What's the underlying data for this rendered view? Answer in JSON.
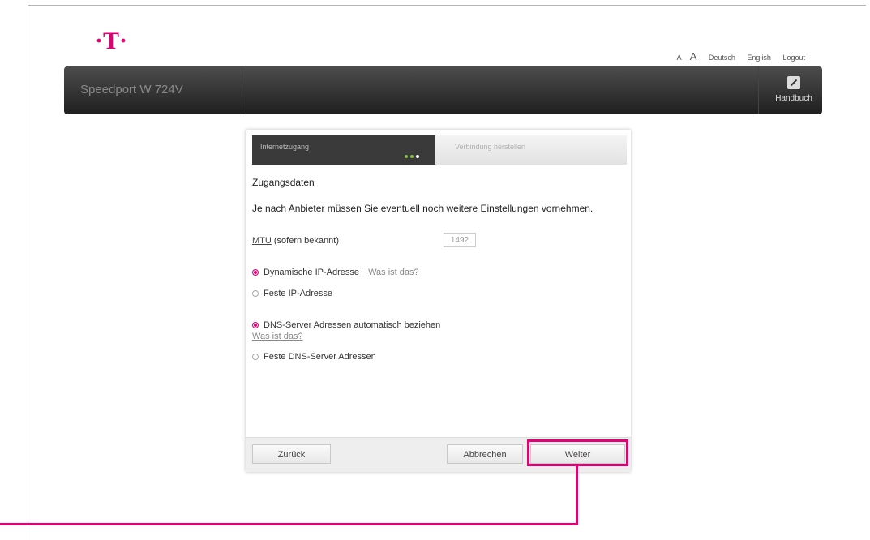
{
  "top_links": {
    "font_small": "A",
    "font_large": "A",
    "lang_de": "Deutsch",
    "lang_en": "English",
    "logout": "Logout"
  },
  "header": {
    "product": "Speedport W 724V",
    "handbook": "Handbuch"
  },
  "wizard": {
    "step1": "Internetzugang",
    "step2": "Verbindung herstellen",
    "title": "Zugangsdaten",
    "intro": "Je nach Anbieter müssen Sie eventuell noch weitere Einstellungen vornehmen.",
    "mtu_abbr": "MTU",
    "mtu_rest": " (sofern bekannt)",
    "mtu_value": "1492",
    "ip_dynamic": "Dynamische IP-Adresse",
    "help_link": "Was ist das?",
    "ip_static": "Feste IP-Adresse",
    "dns_auto": "DNS-Server Adressen automatisch beziehen",
    "dns_help_link": "Was ist das?",
    "dns_static": "Feste DNS-Server Adressen",
    "btn_back": "Zurück",
    "btn_cancel": "Abbrechen",
    "btn_next": "Weiter"
  },
  "colors": {
    "accent": "#e20074",
    "header_bg": "#2e2e2e"
  }
}
